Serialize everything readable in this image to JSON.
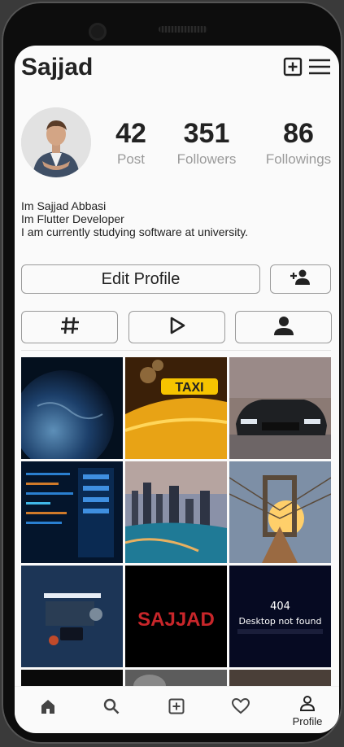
{
  "header": {
    "title": "Sajjad",
    "add_icon": "plus-square-icon",
    "menu_icon": "hamburger-menu-icon"
  },
  "profile": {
    "stats": [
      {
        "value": "42",
        "label": "Post"
      },
      {
        "value": "351",
        "label": "Followers"
      },
      {
        "value": "86",
        "label": "Followings"
      }
    ],
    "bio": [
      "Im Sajjad Abbasi",
      "Im Flutter Developer",
      "I am currently studying software at university."
    ]
  },
  "actions": {
    "edit_label": "Edit Profile",
    "add_user_icon": "person-add-icon"
  },
  "tabs": [
    {
      "icon": "hashtag-icon"
    },
    {
      "icon": "play-icon"
    },
    {
      "icon": "person-icon"
    }
  ],
  "grid": {
    "taxi_sign": "TAXI",
    "sajjad_logo": "SAJJAD",
    "error_code": "404",
    "error_text": "Desktop not found"
  },
  "bottom_nav": [
    {
      "icon": "home-icon",
      "label": ""
    },
    {
      "icon": "search-icon",
      "label": ""
    },
    {
      "icon": "add-box-icon",
      "label": ""
    },
    {
      "icon": "heart-icon",
      "label": ""
    },
    {
      "icon": "profile-icon",
      "label": "Profile"
    }
  ],
  "colors": {
    "background": "#fafafa",
    "text": "#222222",
    "muted": "#9a9a9a",
    "border": "#9a9a9a"
  }
}
